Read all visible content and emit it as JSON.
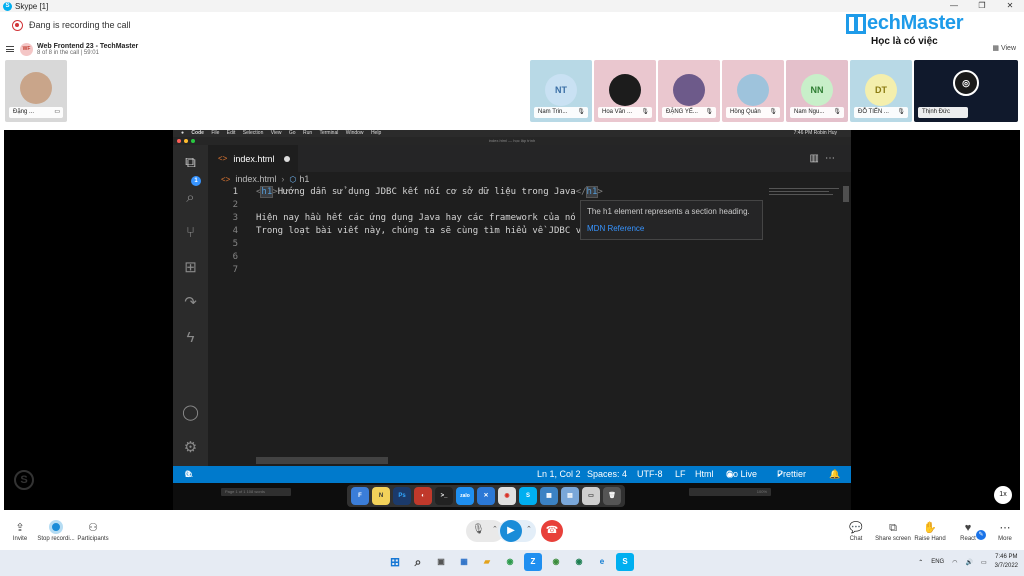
{
  "window": {
    "title": "Skype [1]",
    "controls": [
      "—",
      "❐",
      "✕"
    ]
  },
  "recording": {
    "text": "Đang is recording the call"
  },
  "logo": {
    "name": "echMaster",
    "tagline": "Học là có việc"
  },
  "meeting": {
    "badge": "WF",
    "title": "Web Frontend 23 - TechMaster",
    "subtitle": "8 of 8 in the call | 59:01",
    "view_label": "View"
  },
  "participants": [
    {
      "name": "Đặng ...",
      "initials": "",
      "bg": "#d8d8d8"
    },
    {
      "name": "Nam Trin...",
      "initials": "NT",
      "bg": "#b8d9e6",
      "avatar_bg": "#c9e1f3",
      "avatar_color": "#3a6ea5"
    },
    {
      "name": "Hoa Văn ...",
      "initials": "",
      "bg": "#eac7cf"
    },
    {
      "name": "ĐẶNG YẾ...",
      "initials": "",
      "bg": "#eac7cf"
    },
    {
      "name": "Hồng Quân",
      "initials": "",
      "bg": "#eac7cf"
    },
    {
      "name": "Nam Ngu...",
      "initials": "NN",
      "bg": "#e4c0cb",
      "avatar_bg": "#c8efc9",
      "avatar_color": "#2e7d32"
    },
    {
      "name": "ĐỖ TIẾN ...",
      "initials": "DT",
      "bg": "#b8d9e6",
      "avatar_bg": "#f4efad",
      "avatar_color": "#8a7a10"
    },
    {
      "name": "Thịnh Đức",
      "initials": "",
      "bg": "#10192c"
    }
  ],
  "mac_menu": {
    "items": [
      "Code",
      "File",
      "Edit",
      "Selection",
      "View",
      "Go",
      "Run",
      "Terminal",
      "Window",
      "Help"
    ],
    "right": "7:46 PM   Robin Huy"
  },
  "vscode": {
    "window_title": "index.html — học lập trình",
    "tab": {
      "icon": "<>",
      "name": "index.html"
    },
    "breadcrumb": {
      "file": "index.html",
      "symbol": "h1"
    },
    "lines": [
      {
        "n": "1",
        "open_lt": "<",
        "tag": "h1",
        "open_gt": ">",
        "text": "Hướng dẫn sử dụng JDBC kết nối cơ sở dữ liệu trong Java",
        "close_lt": "</",
        "close_tag": "h1",
        "close_gt": ">"
      },
      {
        "n": "2",
        "text": ""
      },
      {
        "n": "3",
        "text": "Hiện nay hầu hết các ứng dụng Java hay các framework của nó đ"
      },
      {
        "n": "4",
        "text": "Trong loạt bài viết này, chúng ta sẽ cùng tìm hiểu về JDBC và"
      },
      {
        "n": "5",
        "text": ""
      },
      {
        "n": "6",
        "text": ""
      },
      {
        "n": "7",
        "text": ""
      }
    ],
    "hover": {
      "description": "The h1 element represents a section heading.",
      "link": "MDN Reference"
    },
    "status": {
      "errors": "0",
      "warnings": "0",
      "position": "Ln 1, Col 2",
      "spaces": "Spaces: 4",
      "encoding": "UTF-8",
      "eol": "LF",
      "language": "Html",
      "golive": "Go Live",
      "prettier": "Prettier"
    }
  },
  "dock": {
    "left_text": "Page 1 of 1   108 words",
    "right_text": "100%",
    "apps": [
      {
        "label": "F",
        "color": "#3b7dd8"
      },
      {
        "label": "N",
        "color": "#f2d15a"
      },
      {
        "label": "Ps",
        "color": "#1b3a6b"
      },
      {
        "label": "◐",
        "color": "#c0392b"
      },
      {
        "label": ">_",
        "color": "#222"
      },
      {
        "label": "zalo",
        "color": "#1f8ff0"
      },
      {
        "label": "✕",
        "color": "#2b78d6"
      },
      {
        "label": "◉",
        "color": "#e0e0e0"
      },
      {
        "label": "S",
        "color": "#00aff0"
      },
      {
        "label": "▦",
        "color": "#3b82c4"
      },
      {
        "label": "▤",
        "color": "#7aa7d9"
      },
      {
        "label": "▭",
        "color": "#cfcfcf"
      },
      {
        "label": "🗑",
        "color": "#555"
      }
    ]
  },
  "speed": "1x",
  "controls": {
    "invite": "Invite",
    "stop_recording": "Stop recordi...",
    "participants": "Participants",
    "chat": "Chat",
    "share": "Share screen",
    "raise": "Raise Hand",
    "react": "React",
    "more": "More"
  },
  "taskbar": {
    "lang": "ENG",
    "time": "7:46 PM",
    "date": "3/7/2022",
    "apps": [
      {
        "label": "⊞",
        "color": "#1677d4"
      },
      {
        "label": "⌕",
        "color": "#444"
      },
      {
        "label": "▣",
        "color": "#555"
      },
      {
        "label": "▦",
        "color": "#2b70c7"
      },
      {
        "label": "▰",
        "color": "#e3a21a"
      },
      {
        "label": "◉",
        "color": "#2c9a4b"
      },
      {
        "label": "Z",
        "color": "#1f8ff0"
      },
      {
        "label": "◉",
        "color": "#3c8d3c"
      },
      {
        "label": "◉",
        "color": "#1e7f52"
      },
      {
        "label": "e",
        "color": "#0f7bd1"
      },
      {
        "label": "S",
        "color": "#00aff0"
      }
    ]
  },
  "colors": {
    "accent": "#007acc",
    "skype": "#00aff0",
    "end_call": "#e8403a",
    "recording": "#d13438"
  }
}
